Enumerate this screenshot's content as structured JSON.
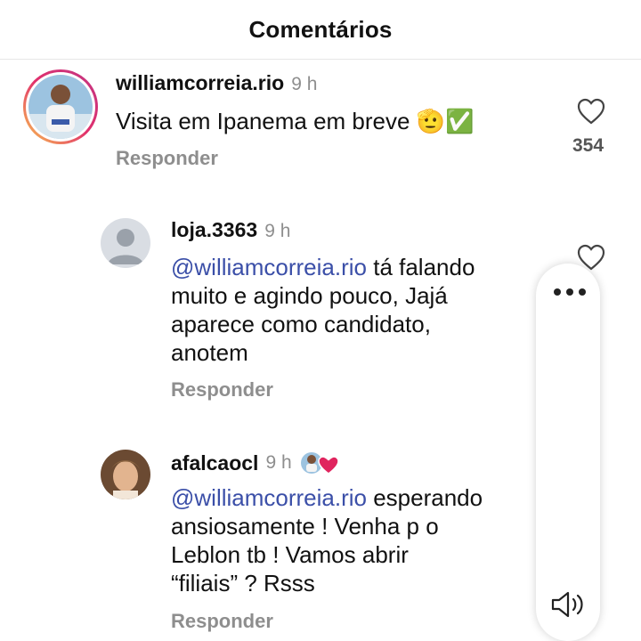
{
  "header": {
    "title": "Comentários"
  },
  "comments": [
    {
      "username": "williamcorreia.rio",
      "time": "9 h",
      "text": "Visita em Ipanema em breve 🫡✅",
      "reply_label": "Responder",
      "like_count": "354",
      "avatar_icon": "user-photo-avatar-story-ring"
    },
    {
      "username": "loja.3363",
      "time": "9 h",
      "mention": "@williamcorreia.rio",
      "text_lines": [
        "tá falando",
        "muito e agindo pouco, Jajá",
        "aparece como candidato,",
        "anotem"
      ],
      "reply_label": "Responder",
      "avatar_icon": "default-user-avatar"
    },
    {
      "username": "afalcaocl",
      "time": "9 h",
      "mention": "@williamcorreia.rio",
      "text_lines": [
        "esperando",
        "ansiosamente ! Venha p o",
        "Leblon tb ! Vamos abrir",
        "“filiais” ? Rsss"
      ],
      "reply_label": "Responder",
      "avatar_icon": "user-photo-avatar",
      "badge_icon": "creator-liked-heart-icon"
    }
  ],
  "overlay_menu": {
    "icons": [
      "more-options-icon",
      "speaker-icon"
    ]
  },
  "colors": {
    "mention": "#3b4fa8",
    "muted": "#8e8e8e",
    "heart": "#e0245e",
    "story_ring": "#dd2a7b"
  }
}
